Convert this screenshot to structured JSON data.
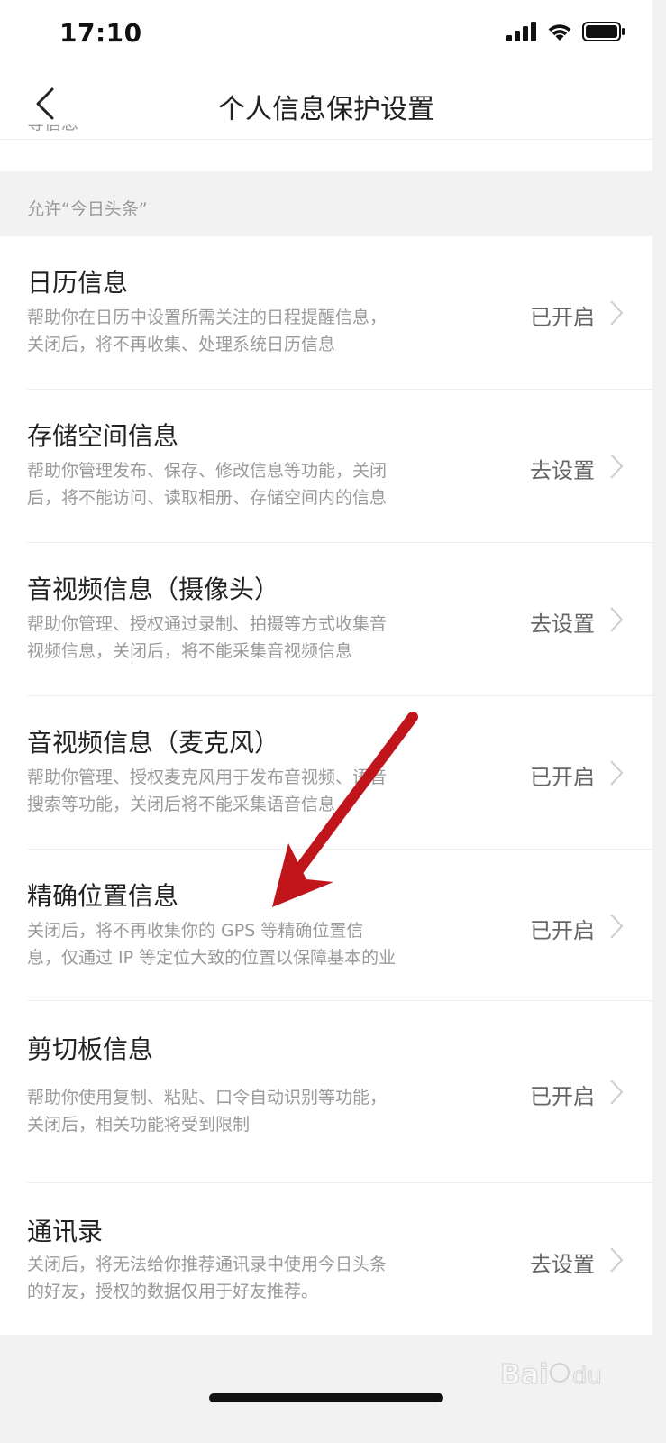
{
  "status_bar": {
    "time": "17:10"
  },
  "nav": {
    "title": "个人信息保护设置"
  },
  "scroll_remnant": "等信息",
  "section": {
    "header": "允许“今日头条”"
  },
  "items": [
    {
      "title": "日历信息",
      "desc": "帮助你在日历中设置所需关注的日程提醒信息，\n关闭后，将不再收集、处理系统日历信息",
      "status": "已开启"
    },
    {
      "title": "存储空间信息",
      "desc": "帮助你管理发布、保存、修改信息等功能，关闭\n后，将不能访问、读取相册、存储空间内的信息",
      "status": "去设置"
    },
    {
      "title": "音视频信息（摄像头）",
      "desc": "帮助你管理、授权通过录制、拍摄等方式收集音\n视频信息，关闭后，将不能采集音视频信息",
      "status": "去设置"
    },
    {
      "title": "音视频信息（麦克风）",
      "desc": "帮助你管理、授权麦克风用于发布音视频、语音\n搜索等功能，关闭后将不能采集语音信息",
      "status": "已开启"
    },
    {
      "title": "精确位置信息",
      "desc": "关闭后，将不再收集你的 GPS 等精确位置信\n息，仅通过 IP 等定位大致的位置以保障基本的业",
      "status": "已开启"
    },
    {
      "title": "剪切板信息",
      "desc": "帮助你使用复制、粘贴、口令自动识别等功能，\n关闭后，相关功能将受到限制",
      "status": "已开启"
    },
    {
      "title": "通讯录",
      "desc": "关闭后，将无法给你推荐通讯录中使用今日头条\n的好友，授权的数据仅用于好友推荐。",
      "status": "去设置"
    }
  ],
  "colors": {
    "annotation_arrow": "#c0161b",
    "chevron": "#cccccc",
    "section_bg": "#f2f2f2"
  },
  "watermark": {
    "text": "Baidu 经验"
  }
}
